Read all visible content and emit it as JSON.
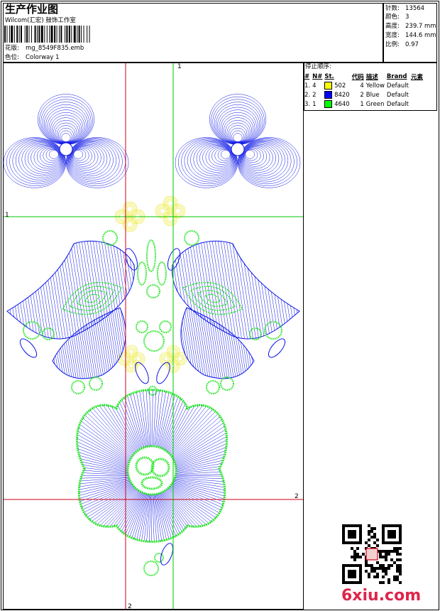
{
  "header": {
    "title": "生产作业图",
    "company": "Wilcom(汇宏) 鼓饰工作室",
    "design_label": "花版:",
    "design_value": "mg_8549F835.emb",
    "colorway_label": "色位:",
    "colorway_value": "Colorway 1"
  },
  "stats": {
    "stitches_label": "针数:",
    "stitches": "13564",
    "colors_label": "颜色:",
    "colors": "3",
    "height_label": "高度:",
    "height": "239.7 mm",
    "width_label": "宽度:",
    "width": "144.6 mm",
    "scale_label": "比例:",
    "scale": "0.97"
  },
  "stop_sequence": {
    "title": "停止顺序:",
    "columns": [
      "#",
      "N#",
      "St.",
      "代码",
      "描述",
      "Brand",
      "元素"
    ],
    "rows": [
      {
        "idx": "1.",
        "n": "4",
        "color": "#ffff00",
        "code": "502",
        "st": "4",
        "desc": "Yellow",
        "brand": "Default"
      },
      {
        "idx": "2.",
        "n": "2",
        "color": "#0000ff",
        "code": "8420",
        "st": "2",
        "desc": "Blue",
        "brand": "Default"
      },
      {
        "idx": "3.",
        "n": "1",
        "color": "#00ff00",
        "code": "4640",
        "st": "1",
        "desc": "Green",
        "brand": "Default"
      }
    ]
  },
  "guides": {
    "v1": "1",
    "h1": "1",
    "h2": "2",
    "v2": "2"
  },
  "colors": {
    "blue": "#0a14e6",
    "green": "#22e622",
    "yellow": "#e8e61a",
    "red": "#d0021b",
    "guide_green": "#00c800"
  },
  "watermark": {
    "text": "6xiu.com"
  }
}
